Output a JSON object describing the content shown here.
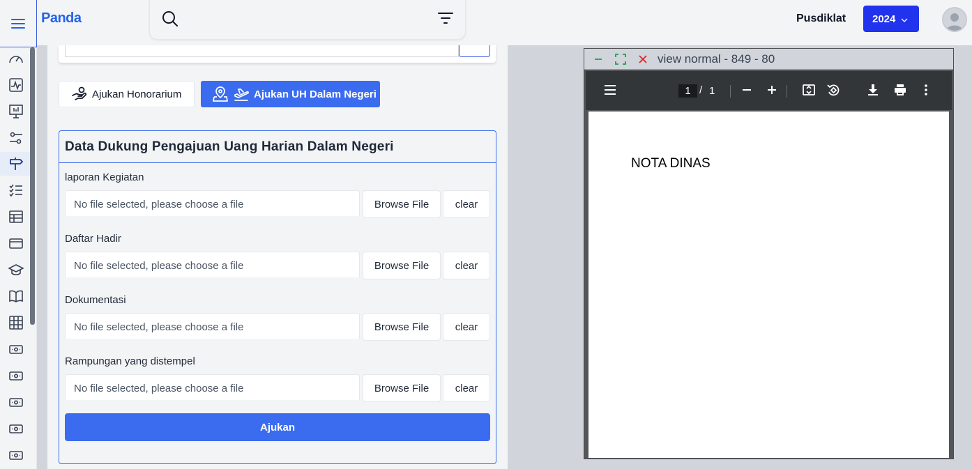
{
  "header": {
    "brand": "Panda",
    "search": {
      "placeholder": ""
    },
    "user_label": "Pusdiklat",
    "year": "2024"
  },
  "sidebar": {
    "items": [
      {
        "icon": "gauge-icon"
      },
      {
        "icon": "activity-chart-icon"
      },
      {
        "icon": "presentation-icon"
      },
      {
        "icon": "sliders-icon"
      },
      {
        "icon": "signpost-icon",
        "active": true
      },
      {
        "icon": "checklist-icon"
      },
      {
        "icon": "table-icon"
      },
      {
        "icon": "credit-card-icon"
      },
      {
        "icon": "graduation-cap-icon"
      },
      {
        "icon": "book-open-icon"
      },
      {
        "icon": "grid-icon"
      },
      {
        "icon": "cash-icon"
      },
      {
        "icon": "cash-icon"
      },
      {
        "icon": "cash-icon"
      },
      {
        "icon": "cash-icon"
      },
      {
        "icon": "cash-icon"
      }
    ]
  },
  "tabs": {
    "honorarium": "Ajukan Honorarium",
    "uh_dalam_negeri": "Ajukan UH Dalam Negeri"
  },
  "form": {
    "title": "Data Dukung Pengajuan Uang Harian Dalam Negeri",
    "fields": [
      {
        "label": "laporan Kegiatan",
        "value": "No file selected, please choose a file",
        "browse": "Browse File",
        "clear": "clear"
      },
      {
        "label": "Daftar Hadir",
        "value": "No file selected, please choose a file",
        "browse": "Browse File",
        "clear": "clear"
      },
      {
        "label": "Dokumentasi",
        "value": "No file selected, please choose a file",
        "browse": "Browse File",
        "clear": "clear"
      },
      {
        "label": "Rampungan yang distempel",
        "value": "No file selected, please choose a file",
        "browse": "Browse File",
        "clear": "clear"
      }
    ],
    "submit": "Ajukan"
  },
  "viewer": {
    "title": "view normal - 849 - 80",
    "page_current": "1",
    "page_separator": "/",
    "page_total": "1",
    "document_text": "NOTA DINAS"
  },
  "colors": {
    "primary": "#3b6cf0",
    "year_button": "#2233ee",
    "brand": "#2563eb",
    "minimize": "#16a34a",
    "close": "#dc2626"
  }
}
